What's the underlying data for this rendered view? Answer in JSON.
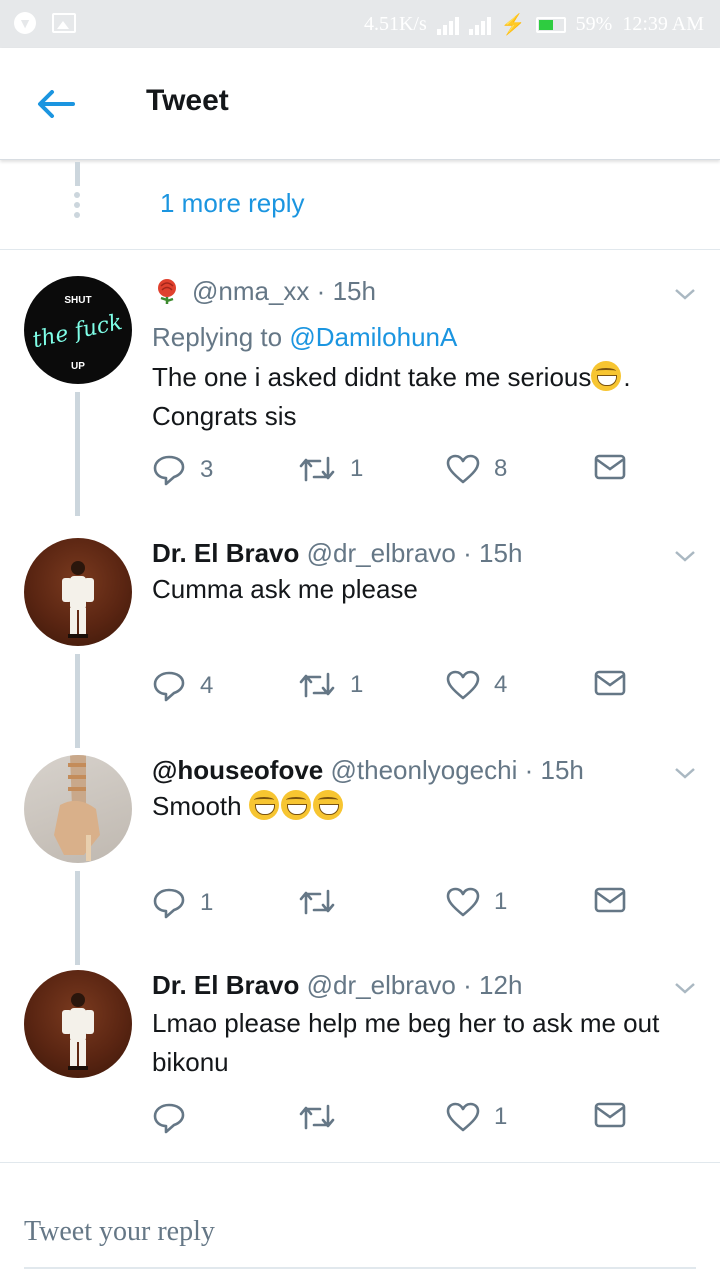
{
  "status_bar": {
    "speed": "4.51K/s",
    "battery": "59%",
    "battery_level": 0.59,
    "time": "12:39 AM"
  },
  "header": {
    "title": "Tweet"
  },
  "more_reply": {
    "label": "1 more reply"
  },
  "tweets": [
    {
      "name": "",
      "handle": "@nma_xx",
      "sep": "·",
      "time": "15h",
      "replying_prefix": "Replying to",
      "replying_to": "@DamilohunA",
      "text_line1": "The one i asked didnt take me serious",
      "text_line1_end": ".",
      "text_line2": "Congrats sis",
      "avatar_text_top": "SHUT",
      "avatar_text_mid": "the fuck",
      "avatar_text_bot": "UP",
      "replies": "3",
      "retweets": "1",
      "likes": "8"
    },
    {
      "name": "Dr. El Bravo",
      "handle": "@dr_elbravo",
      "sep": "·",
      "time": "15h",
      "text": "Cumma ask me please",
      "replies": "4",
      "retweets": "1",
      "likes": "4"
    },
    {
      "name": "@houseofove",
      "handle": "@theonlyogechi",
      "sep": "·",
      "time": "15h",
      "text": "Smooth",
      "replies": "1",
      "retweets": "",
      "likes": "1"
    },
    {
      "name": "Dr. El Bravo",
      "handle": "@dr_elbravo",
      "sep": "·",
      "time": "12h",
      "text_line1": "Lmao please help me beg her to ask me out",
      "text_line2": "bikonu",
      "replies": "",
      "retweets": "",
      "likes": "1"
    }
  ],
  "compose": {
    "placeholder": "Tweet your reply"
  },
  "colors": {
    "accent": "#1b95e0",
    "muted": "#657786",
    "text": "#14171a",
    "thread_line": "#ccd6dd",
    "status_bar": "#e6e8ea"
  }
}
